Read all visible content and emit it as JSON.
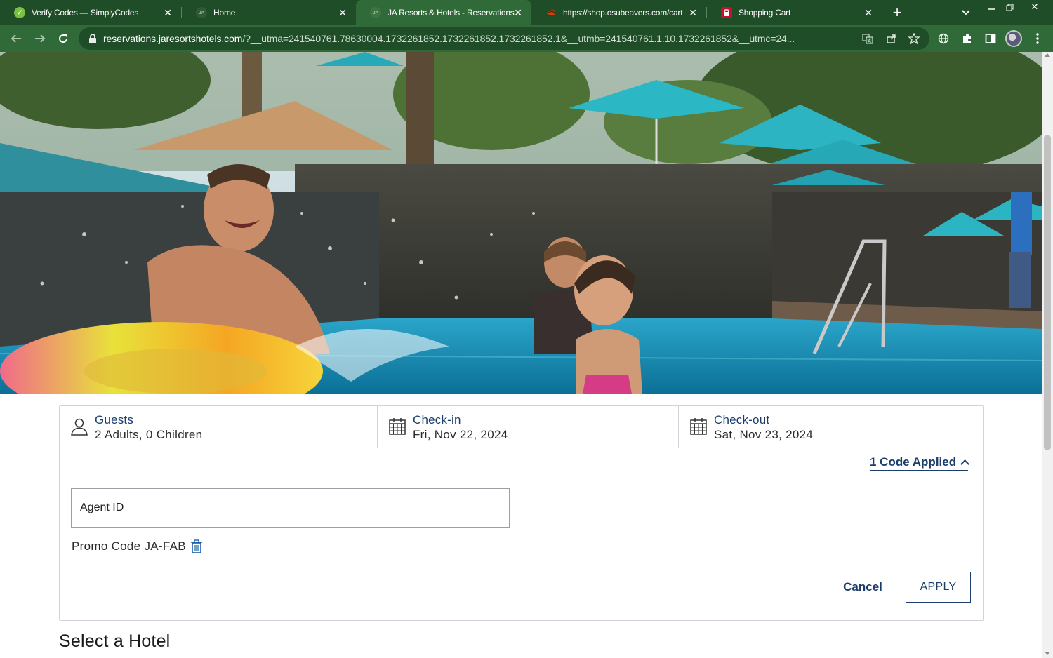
{
  "browser": {
    "tabs": [
      {
        "title": "Verify Codes — SimplyCodes",
        "favicon": "simplycodes-check-icon",
        "active": false
      },
      {
        "title": "Home",
        "favicon": "ja-resorts-logo-icon",
        "active": false
      },
      {
        "title": "JA Resorts & Hotels - Reservations",
        "favicon": "ja-resorts-logo-icon",
        "active": true
      },
      {
        "title": "https://shop.osubeavers.com/cart",
        "favicon": "osu-beavers-logo-icon",
        "active": false
      },
      {
        "title": "Shopping Cart",
        "favicon": "shopping-cart-store-icon",
        "active": false
      }
    ],
    "url_host": "reservations.jaresortshotels.com",
    "url_rest": "/?__utma=241540761.78630004.1732261852.1732261852.1732261852.1&__utmb=241540761.1.10.1732261852&__utmc=24...",
    "colors": {
      "frame": "#1f4d27",
      "toolbar": "#2f6a38"
    }
  },
  "booking": {
    "guests": {
      "label": "Guests",
      "value": "2 Adults, 0 Children"
    },
    "checkin": {
      "label": "Check-in",
      "value": "Fri, Nov 22, 2024"
    },
    "checkout": {
      "label": "Check-out",
      "value": "Sat, Nov 23, 2024"
    },
    "code_toggle": "1 Code Applied",
    "agent_placeholder": "Agent ID",
    "promo_text": "Promo Code JA-FAB",
    "cancel_label": "Cancel",
    "apply_label": "APPLY",
    "accent_color": "#1b3d6b"
  },
  "section_title": "Select a Hotel"
}
